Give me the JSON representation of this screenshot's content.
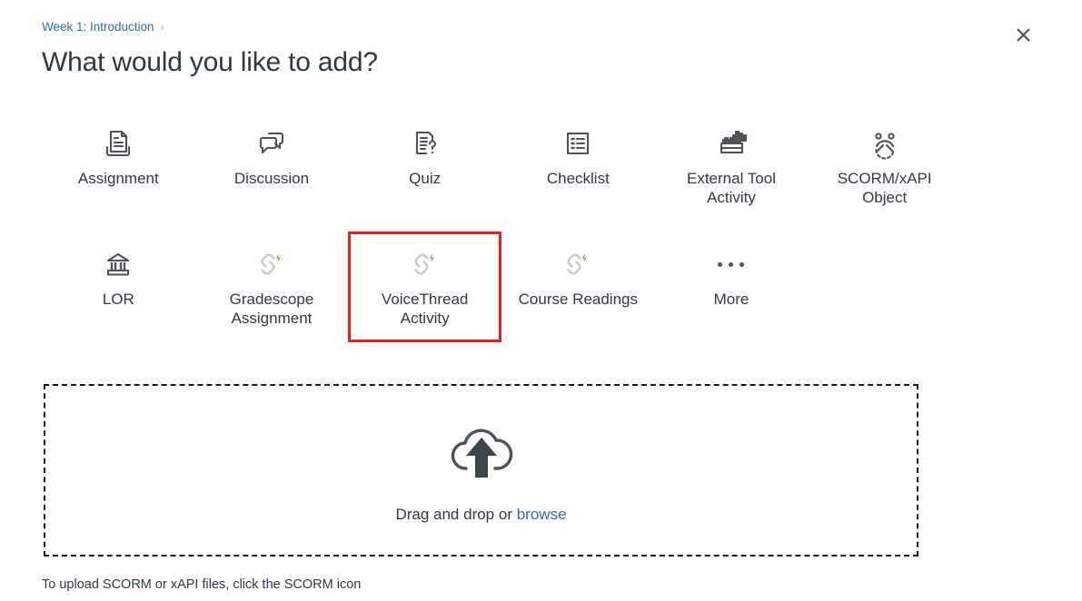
{
  "breadcrumb": {
    "link_label": "Week 1: Introduction",
    "separator": "›"
  },
  "header": {
    "title": "What would you like to add?",
    "close_label": "×"
  },
  "colors": {
    "link": "#2b6cb8",
    "text": "#2d3b45",
    "icon": "#4b5458",
    "highlight": "#e8201f",
    "lti_chain": "#c9cbcd",
    "lti_spark": "#ee6a1e"
  },
  "grid": {
    "tiles": [
      {
        "label": "Assignment",
        "icon": "assignment-icon",
        "highlighted": false
      },
      {
        "label": "Discussion",
        "icon": "discussion-icon",
        "highlighted": false
      },
      {
        "label": "Quiz",
        "icon": "quiz-icon",
        "highlighted": false
      },
      {
        "label": "Checklist",
        "icon": "checklist-icon",
        "highlighted": false
      },
      {
        "label": "External Tool Activity",
        "icon": "external-tool-icon",
        "highlighted": false
      },
      {
        "label": "SCORM/xAPI Object",
        "icon": "scorm-icon",
        "highlighted": false
      },
      {
        "label": "LOR",
        "icon": "lor-icon",
        "highlighted": false
      },
      {
        "label": "Gradescope Assignment",
        "icon": "lti-link-icon",
        "highlighted": false
      },
      {
        "label": "VoiceThread Activity",
        "icon": "lti-link-icon",
        "highlighted": true
      },
      {
        "label": "Course Readings",
        "icon": "lti-link-icon",
        "highlighted": false
      },
      {
        "label": "More",
        "icon": "more-dots-icon",
        "highlighted": false
      }
    ]
  },
  "dropzone": {
    "prompt": "Drag and drop or",
    "browse_label": "browse",
    "icon": "cloud-upload-icon"
  },
  "footnote": {
    "text": "To upload SCORM or xAPI files, click the SCORM icon"
  }
}
